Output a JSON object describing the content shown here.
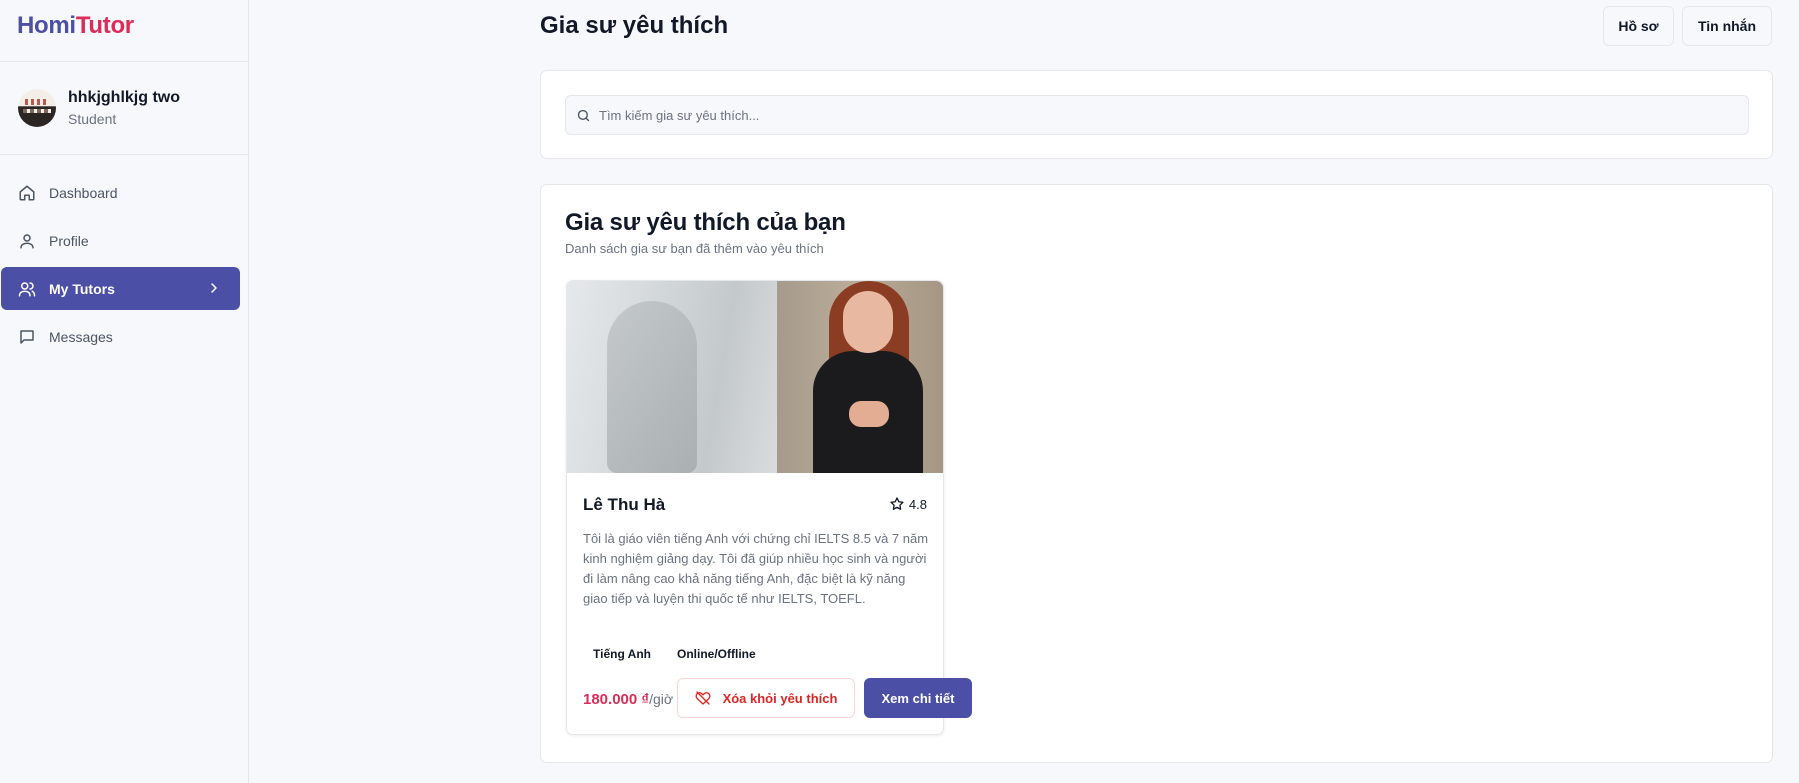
{
  "brand": {
    "part1": "Homi",
    "part2": "Tutor"
  },
  "user": {
    "name": "hhkjghlkjg two",
    "role": "Student"
  },
  "nav": [
    {
      "label": "Dashboard",
      "icon": "home-icon"
    },
    {
      "label": "Profile",
      "icon": "user-icon"
    },
    {
      "label": "My Tutors",
      "icon": "users-icon",
      "active": true
    },
    {
      "label": "Messages",
      "icon": "message-icon"
    }
  ],
  "header": {
    "title": "Gia sư yêu thích",
    "profile_label": "Hồ sơ",
    "messages_label": "Tin nhắn"
  },
  "search": {
    "placeholder": "Tìm kiếm gia sư yêu thích..."
  },
  "favorites": {
    "title": "Gia sư yêu thích của bạn",
    "subtitle": "Danh sách gia sư bạn đã thêm vào yêu thích",
    "tutors": [
      {
        "name": "Lê Thu Hà",
        "rating": "4.8",
        "bio": "Tôi là giáo viên tiếng Anh với chứng chỉ IELTS 8.5 và 7 năm kinh nghiệm giảng dạy. Tôi đã giúp nhiều học sinh và người đi làm nâng cao khả năng tiếng Anh, đặc biệt là kỹ năng giao tiếp và luyện thi quốc tế như IELTS, TOEFL.",
        "tags": [
          "Tiếng Anh",
          "Online/Offline"
        ],
        "price": "180.000 ₫",
        "price_unit": "/giờ",
        "remove_label": "Xóa khỏi yêu thích",
        "detail_label": "Xem chi tiết"
      }
    ]
  },
  "colors": {
    "primary": "#4c4fa6",
    "accent": "#db2c5a",
    "danger": "#dc2626"
  }
}
